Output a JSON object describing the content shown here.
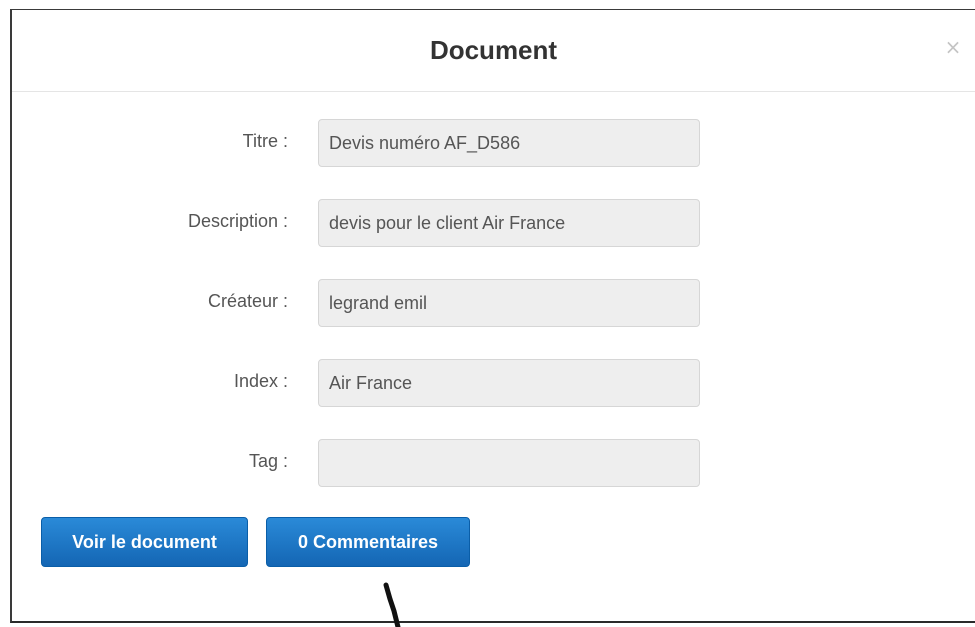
{
  "modal": {
    "title": "Document",
    "close_label": "×"
  },
  "fields": [
    {
      "label": "Titre :",
      "value": "Devis numéro AF_D586"
    },
    {
      "label": "Description :",
      "value": "devis pour le client Air France"
    },
    {
      "label": "Créateur :",
      "value": "legrand emil"
    },
    {
      "label": "Index :",
      "value": "Air France"
    },
    {
      "label": "Tag :",
      "value": ""
    }
  ],
  "buttons": {
    "view_document_label": "Voir le document",
    "comments_label": "0 Commentaires"
  },
  "colors": {
    "button_primary": "#1a73c2",
    "input_background": "#eeeeee",
    "title_text": "#333333",
    "label_text": "#555555"
  },
  "icons": {
    "close": "close-icon"
  }
}
